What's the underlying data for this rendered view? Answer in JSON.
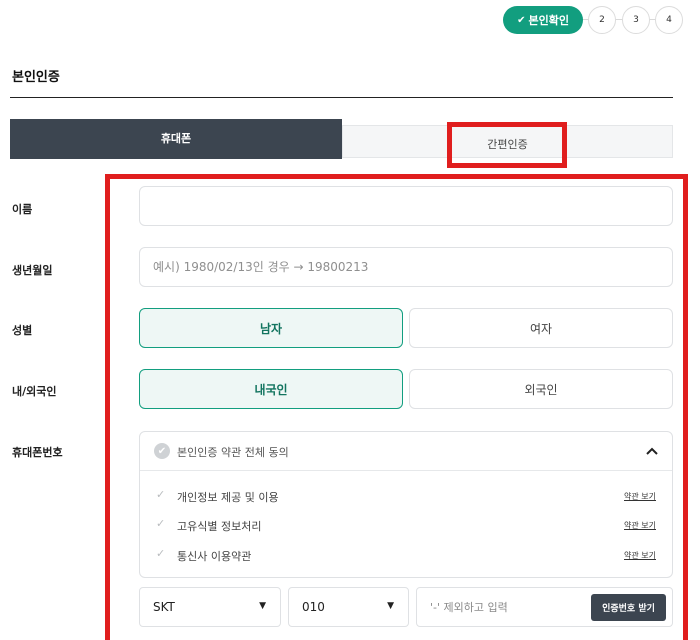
{
  "stepper": {
    "active_label": "본인확인",
    "steps": [
      "2",
      "3",
      "4"
    ]
  },
  "page_title": "본인인증",
  "tabs": {
    "phone": "휴대폰",
    "simple": "간편인증"
  },
  "form": {
    "name": {
      "label": "이름",
      "value": "",
      "placeholder": ""
    },
    "birth": {
      "label": "생년월일",
      "value": "",
      "placeholder": "예시) 1980/02/13인 경우 → 19800213"
    },
    "gender": {
      "label": "성별",
      "options": [
        "남자",
        "여자"
      ],
      "selected": "남자"
    },
    "nationality": {
      "label": "내/외국인",
      "options": [
        "내국인",
        "외국인"
      ],
      "selected": "내국인"
    },
    "phone_label": "휴대폰번호"
  },
  "consent": {
    "all_label": "본인인증 약관 전체 동의",
    "items": [
      {
        "label": "개인정보 제공 및 이용",
        "link": "약관 보기"
      },
      {
        "label": "고유식별 정보처리",
        "link": "약관 보기"
      },
      {
        "label": "통신사 이용약관",
        "link": "약관 보기"
      }
    ]
  },
  "phone": {
    "carrier": "SKT",
    "prefix": "010",
    "number_placeholder": "'-' 제외하고 입력",
    "verify_button": "인증번호 받기"
  },
  "colors": {
    "accent": "#129e7f",
    "dark": "#3c4550",
    "highlight": "#e01e1e"
  }
}
